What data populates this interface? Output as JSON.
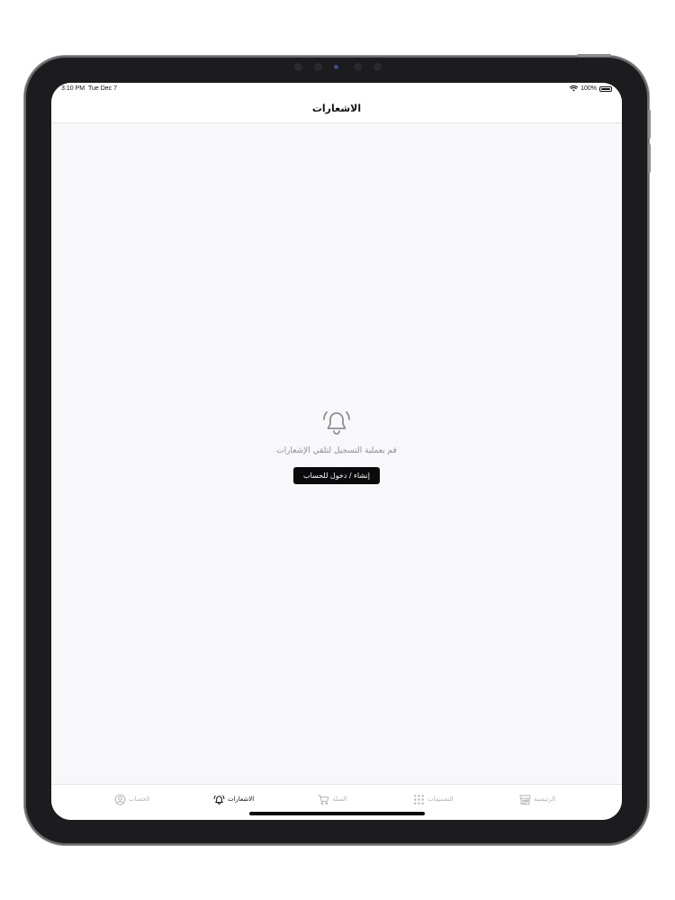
{
  "status_bar": {
    "time": "3:10 PM",
    "date": "Tue Dec 7",
    "battery_percent": "100%"
  },
  "nav": {
    "title": "الاشعارات"
  },
  "empty_state": {
    "icon": "bell-ringing-icon",
    "message": "قم بعملية التسجيل لتلقي الإشعارات",
    "button_label": "إنشاء / دخول للحساب"
  },
  "tab_bar": {
    "active_tab": "notifications",
    "tabs": [
      {
        "id": "account",
        "label": "الحساب",
        "icon": "user-circle-icon"
      },
      {
        "id": "notifications",
        "label": "الاشعارات",
        "icon": "bell-icon"
      },
      {
        "id": "cart",
        "label": "السلة",
        "icon": "cart-icon"
      },
      {
        "id": "categories",
        "label": "التصنيفات",
        "icon": "grid-dots-icon"
      },
      {
        "id": "home",
        "label": "الرئيسية",
        "icon": "store-icon"
      }
    ]
  },
  "colors": {
    "background": "#f8f7fa",
    "button": "#0b0b0d",
    "inactive_tab": "#b4b4b9",
    "active_tab": "#111111",
    "muted_text": "#8e8e93"
  }
}
